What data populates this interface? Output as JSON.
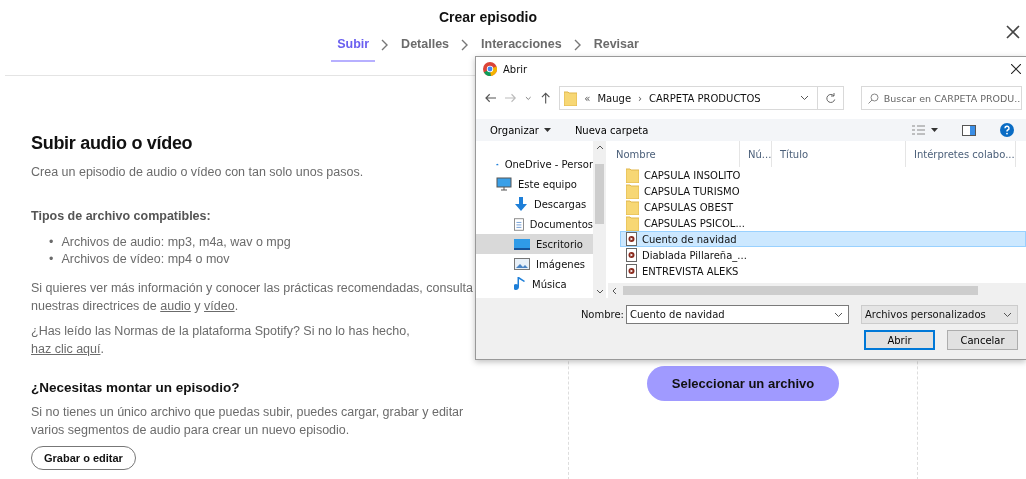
{
  "header": {
    "title": "Crear episodio",
    "steps": [
      {
        "label": "Subir",
        "selected": true
      },
      {
        "label": "Detalles",
        "selected": false
      },
      {
        "label": "Interacciones",
        "selected": false
      },
      {
        "label": "Revisar",
        "selected": false
      }
    ]
  },
  "intro": {
    "heading": "Subir audio o vídeo",
    "subtitle": "Crea un episodio de audio o vídeo con tan solo unos pasos.",
    "types_heading": "Tipos de archivo compatibles:",
    "types": [
      {
        "bullet": "•",
        "text": "Archivos de audio: mp3, m4a, wav o mpg"
      },
      {
        "bullet": "•",
        "text": "Archivos de vídeo: mp4 o mov"
      }
    ],
    "paragraphs": [
      [
        {
          "kind": "text",
          "text": "Si quieres ver más información y conocer las prácticas recomendadas, consulta nuestras directrices de "
        },
        {
          "kind": "link",
          "text": "audio"
        },
        {
          "kind": "text",
          "text": " y "
        },
        {
          "kind": "link",
          "text": "vídeo"
        },
        {
          "kind": "text",
          "text": "."
        }
      ],
      [
        {
          "kind": "text",
          "text": "¿Has leído las Normas de la plataforma Spotify? Si no lo has hecho, "
        },
        {
          "kind": "link",
          "text": "haz clic aquí"
        },
        {
          "kind": "text",
          "text": "."
        }
      ]
    ]
  },
  "montar": {
    "heading": "¿Necesitas montar un episodio?",
    "text": "Si no tienes un único archivo que puedas subir, puedes cargar, grabar y editar varios segmentos de audio para crear un nuevo episodio.",
    "button": "Grabar o editar"
  },
  "upload": {
    "button": "Seleccionar un archivo"
  },
  "dialog": {
    "title": "Abrir",
    "path": [
      "«",
      "Mauge",
      "CARPETA PRODUCTOS"
    ],
    "path_separator": "›",
    "search": {
      "placeholder": "Buscar en CARPETA PRODU..."
    },
    "toolbar": [
      "Organizar",
      "Nueva carpeta"
    ],
    "nav": [
      {
        "label": "OneDrive - Persor",
        "kind": "cloud",
        "selected": false
      },
      {
        "label": "Este equipo",
        "kind": "computer",
        "selected": false,
        "children": [
          {
            "label": "Descargas",
            "kind": "download",
            "selected": false
          },
          {
            "label": "Documentos",
            "kind": "document",
            "selected": false
          },
          {
            "label": "Escritorio",
            "kind": "desktop",
            "selected": true
          },
          {
            "label": "Imágenes",
            "kind": "images",
            "selected": false
          },
          {
            "label": "Música",
            "kind": "music",
            "selected": false
          }
        ]
      }
    ],
    "columns": [
      "Nombre",
      "Nú...",
      "Título",
      "Intérpretes colabo..."
    ],
    "files": [
      {
        "name": "CAPSULA INSOLITO",
        "kind": "folder",
        "selected": false
      },
      {
        "name": "CAPSULA TURISMO",
        "kind": "folder",
        "selected": false
      },
      {
        "name": "CAPSULAS OBEST",
        "kind": "folder",
        "selected": false
      },
      {
        "name": "CAPSULAS PSICOL...",
        "kind": "folder",
        "selected": false
      },
      {
        "name": "Cuento de navidad",
        "kind": "media",
        "selected": true
      },
      {
        "name": "Diablada Pillareña_...",
        "kind": "media",
        "selected": false
      },
      {
        "name": "ENTREVISTA ALEKS",
        "kind": "media",
        "selected": false
      }
    ],
    "filename_label": "Nombre:",
    "filename": "Cuento de navidad",
    "filter": "Archivos personalizados",
    "buttons": [
      {
        "label": "Abrir",
        "kind": "default"
      },
      {
        "label": "Cancelar",
        "kind": "normal"
      }
    ]
  }
}
